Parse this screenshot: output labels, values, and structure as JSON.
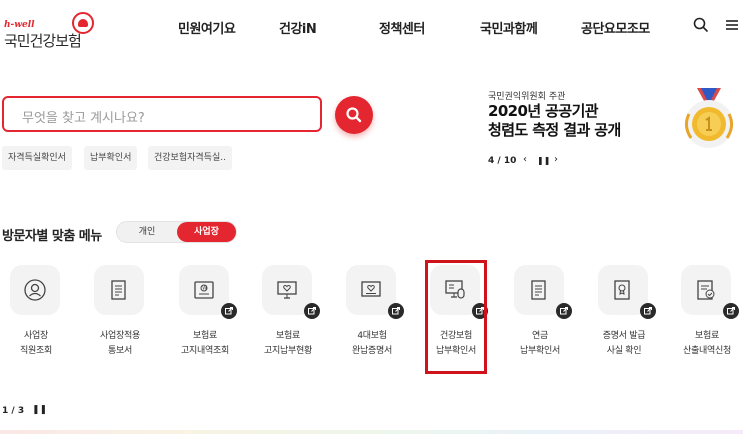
{
  "header": {
    "logo_small": "h-well",
    "logo_main": "국민건강보험",
    "nav": [
      "민원여기요",
      "건강iN",
      "정책센터",
      "국민과함께",
      "공단요모조모"
    ],
    "icons": [
      "search-icon",
      "menu-icon"
    ]
  },
  "search": {
    "placeholder": "무엇을 찾고 계시나요?",
    "chips": [
      "자격득실확인서",
      "납부확인서",
      "건강보험자격득실.."
    ]
  },
  "banner": {
    "org": "국민권익위원회 주관",
    "title_line1": "2020년 공공기관",
    "title_line2": "청렴도 측정 결과 공개",
    "pager": "4 / 10",
    "prev": "‹",
    "pause": "❚❚",
    "next": "›"
  },
  "custom_menu": {
    "title": "방문자별 맞춤 메뉴",
    "toggle": [
      "개인",
      "사업장"
    ],
    "selected": "사업장",
    "items": [
      {
        "line1": "사업장",
        "line2": "직원조회",
        "icon": "person-search-icon",
        "external": false
      },
      {
        "line1": "사업장적용",
        "line2": "통보서",
        "icon": "document-icon",
        "external": false
      },
      {
        "line1": "보험료",
        "line2": "고지내역조회",
        "icon": "bill-icon",
        "external": true
      },
      {
        "line1": "보험료",
        "line2": "고지납부현황",
        "icon": "monitor-heart-icon",
        "external": true
      },
      {
        "line1": "4대보험",
        "line2": "완납증명서",
        "icon": "certificate-icon",
        "external": true
      },
      {
        "line1": "건강보험",
        "line2": "납부확인서",
        "icon": "computer-mouse-icon",
        "external": true
      },
      {
        "line1": "연금",
        "line2": "납부확인서",
        "icon": "document-icon",
        "external": true
      },
      {
        "line1": "증명서 발급",
        "line2": "사실 확인",
        "icon": "award-certificate-icon",
        "external": true
      },
      {
        "line1": "보험료",
        "line2": "산출내역신청",
        "icon": "document-check-icon",
        "external": true
      }
    ],
    "pager": "1 / 3",
    "pause": "❚❚"
  },
  "colors": {
    "accent": "#e3262f",
    "highlight": "#d0121b",
    "chip_bg": "#f3f3f3",
    "badge": "#2a2a2a"
  }
}
